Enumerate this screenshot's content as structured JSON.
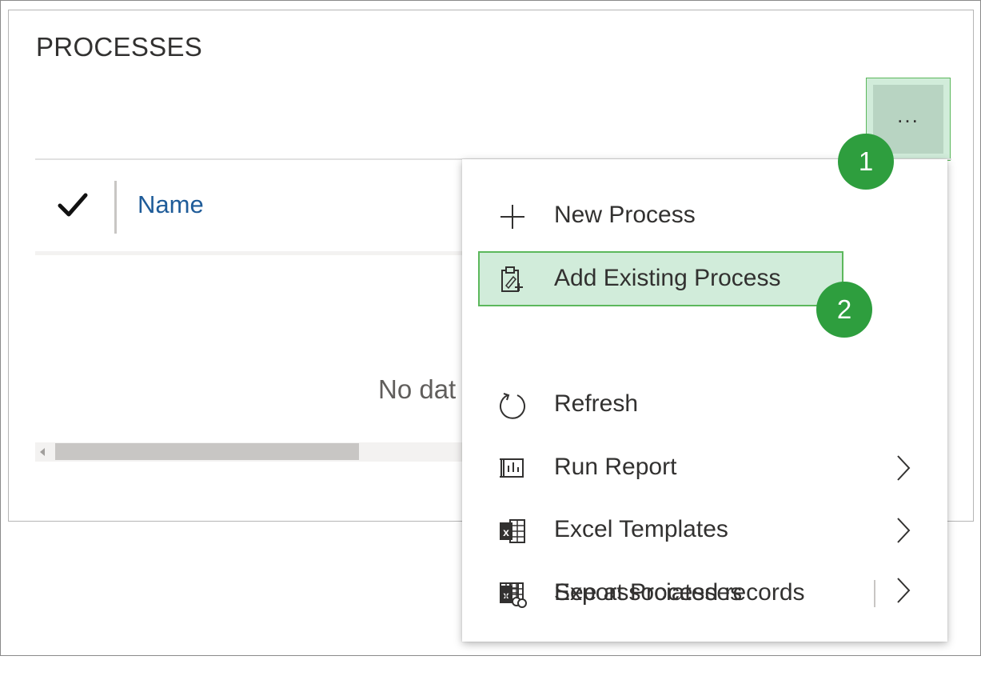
{
  "panel": {
    "title": "PROCESSES",
    "more_label": "...",
    "grid": {
      "column_name": "Name",
      "empty_message": "No dat"
    }
  },
  "menu": {
    "items": [
      {
        "label": "New Process",
        "icon": "plus-icon",
        "has_submenu": false
      },
      {
        "label": "Add Existing Process",
        "icon": "clipboard-add-icon",
        "has_submenu": false,
        "highlighted": true
      },
      {
        "label": "Refresh",
        "icon": "refresh-icon",
        "has_submenu": false
      },
      {
        "label": "Run Report",
        "icon": "report-icon",
        "has_submenu": true
      },
      {
        "label": "Excel Templates",
        "icon": "excel-icon",
        "has_submenu": true
      },
      {
        "label": "Export Processes",
        "icon": "excel-export-icon",
        "has_submenu": true,
        "split": true
      },
      {
        "label": "See associated records",
        "icon": "associated-records-icon",
        "has_submenu": false
      }
    ]
  },
  "callouts": {
    "step1": "1",
    "step2": "2"
  },
  "colors": {
    "callout_green": "#2e9e3e",
    "highlight_fill": "#d1ecda",
    "highlight_border": "#5cb85c",
    "link_blue": "#1f5c99"
  }
}
